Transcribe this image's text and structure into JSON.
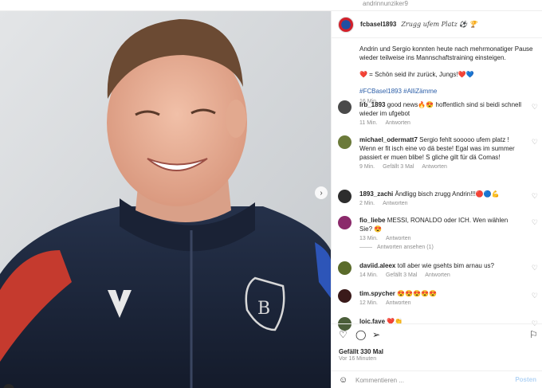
{
  "top": {
    "partial_text": "andrinnunziker9"
  },
  "photo": {
    "next_icon": "chevron-right-icon",
    "dots_total": 6,
    "dots_active": 0,
    "tag_icon": "person-icon"
  },
  "post": {
    "username": "fcbasel1893",
    "title_extra": "Zrugg ufem Platz ⚽ 🏆",
    "caption_line1": "Andrin und Sergio konnten heute nach mehrmonatiger Pause wieder teilweise ins Mannschaftstraining einsteigen.",
    "caption_line2": "❤️ = Schön seid ihr zurück, Jungs!❤️💙",
    "hashtags": "#FCBasel1893 #AlliZämme",
    "time": "16 Min."
  },
  "comments": [
    {
      "user": "lrb_1893",
      "text": "good news🔥😍 hoffentlich sind si beidi schnell wieder im ufgebot",
      "time": "11 Min.",
      "likes": "",
      "reply": "Antworten",
      "avatar": "#4a4a4a"
    },
    {
      "user": "michael_odermatt7",
      "text": "Sergio fehlt sooooo ufem platz ! Wenn er fit isch eine vo dä beste! Egal was im summer passiert er muen blibe! S gliche gilt für dä Comas!",
      "time": "9 Min.",
      "likes": "Gefällt 3 Mal",
      "reply": "Antworten",
      "avatar": "#6b7a3a"
    },
    {
      "user": "1893_zachi",
      "text": "Ändligg bisch zrugg Andrin!!!🔴🔵💪",
      "time": "2 Min.",
      "likes": "",
      "reply": "Antworten",
      "avatar": "#2d2d2d"
    },
    {
      "user": "fio_liebe",
      "text": "MESSI, RONALDO oder ICH. Wen wählen Sie? 😍",
      "time": "13 Min.",
      "likes": "",
      "reply": "Antworten",
      "avatar": "#8b2a6b"
    },
    {
      "user": "daviid.aleex",
      "text": "toll aber wie gsehts bim arnau us?",
      "time": "14 Min.",
      "likes": "Gefällt 3 Mal",
      "reply": "Antworten",
      "avatar": "#5a6b2a"
    },
    {
      "user": "tim.spycher",
      "text": "😍😍😍😍😍",
      "time": "12 Min.",
      "likes": "",
      "reply": "Antworten",
      "avatar": "#3a1a1a"
    },
    {
      "user": "loic.fave",
      "text": "❤️👏",
      "time": "",
      "likes": "",
      "reply": "",
      "avatar": "#4b5e3a"
    }
  ],
  "view_replies": "Antworten ansehen (1)",
  "actions": {
    "like_icon": "heart-icon",
    "comment_icon": "comment-icon",
    "share_icon": "send-icon",
    "save_icon": "bookmark-icon"
  },
  "likes_count": "Gefällt 330 Mal",
  "posted_ago": "Vor 16 Minuten",
  "compose": {
    "placeholder": "Kommentieren ...",
    "post_label": "Posten"
  }
}
